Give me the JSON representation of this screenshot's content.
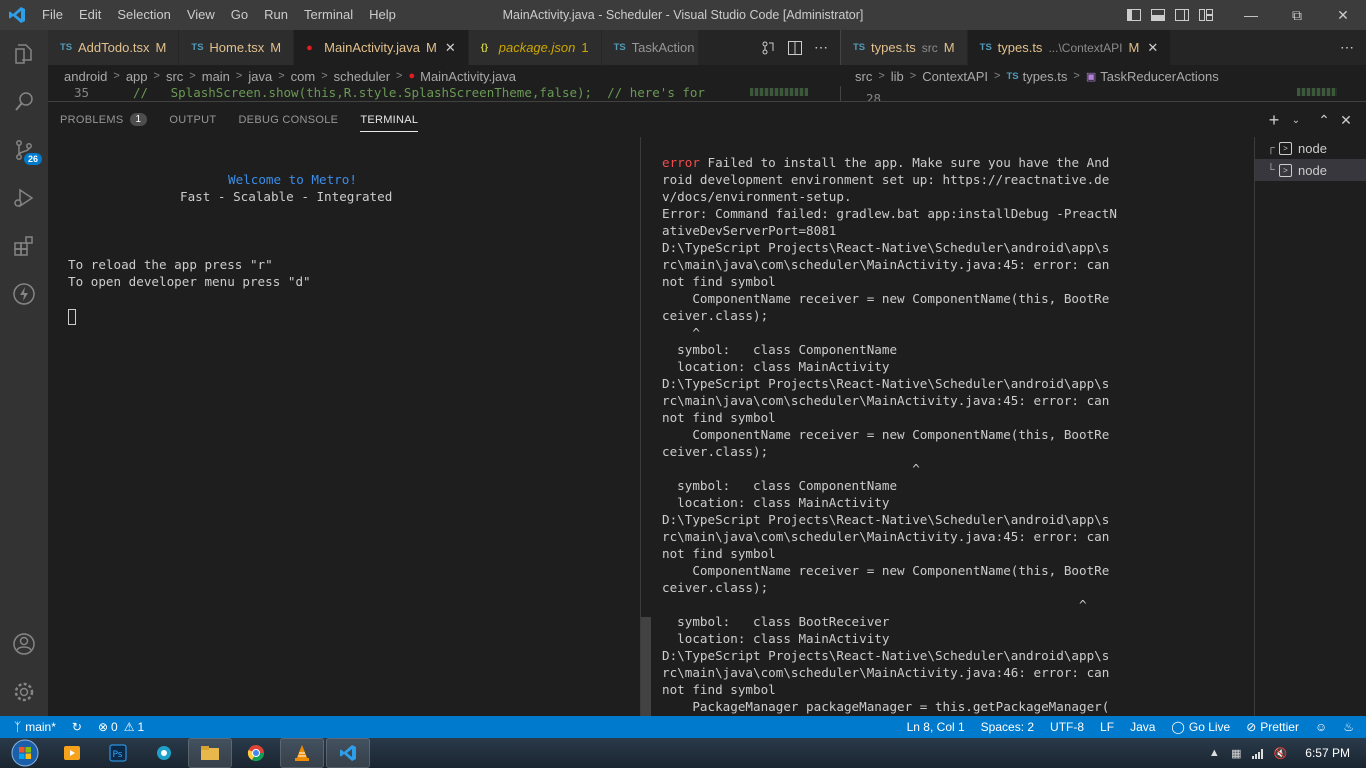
{
  "window": {
    "title": "MainActivity.java - Scheduler - Visual Studio Code [Administrator]",
    "menu": [
      "File",
      "Edit",
      "Selection",
      "View",
      "Go",
      "Run",
      "Terminal",
      "Help"
    ]
  },
  "activity_bar": {
    "scm_badge": "26"
  },
  "tabs_left": [
    {
      "icon": "TS",
      "label": "AddTodo.tsx",
      "status": "M"
    },
    {
      "icon": "TS",
      "label": "Home.tsx",
      "status": "M"
    },
    {
      "icon": "J",
      "label": "MainActivity.java",
      "status": "M"
    },
    {
      "icon": "{}",
      "label": "package.json",
      "status": "1"
    },
    {
      "icon": "TS",
      "label": "TaskAction"
    }
  ],
  "tabs_right": [
    {
      "icon": "TS",
      "label": "types.ts",
      "desc": "src",
      "status": "M"
    },
    {
      "icon": "TS",
      "label": "types.ts",
      "desc": "...\\ContextAPI",
      "status": "M"
    }
  ],
  "breadcrumbs_left": [
    "android",
    "app",
    "src",
    "main",
    "java",
    "com",
    "scheduler",
    "MainActivity.java"
  ],
  "breadcrumbs_right": [
    "src",
    "lib",
    "ContextAPI",
    "types.ts",
    "TaskReducerActions"
  ],
  "editor": {
    "line_number": "35",
    "line_text": "//   SplashScreen.show(this,R.style.SplashScreenTheme,false);  // here's for",
    "right_line_number": "28"
  },
  "panel": {
    "tabs": [
      {
        "label": "PROBLEMS",
        "badge": "1"
      },
      {
        "label": "OUTPUT"
      },
      {
        "label": "DEBUG CONSOLE"
      },
      {
        "label": "TERMINAL"
      }
    ],
    "terminal_left": {
      "welcome": "Welcome to Metro!",
      "tagline": "Fast - Scalable - Integrated",
      "reload_hint": "To reload the app press \"r\"",
      "devmenu_hint": "To open developer menu press \"d\""
    },
    "terminal_right": {
      "error_word": "error",
      "first_line_rest": " Failed to install the app. Make sure you have the And",
      "lines": [
        "roid development environment set up: https://reactnative.de",
        "v/docs/environment-setup.",
        "Error: Command failed: gradlew.bat app:installDebug -PreactN",
        "ativeDevServerPort=8081",
        "D:\\TypeScript Projects\\React-Native\\Scheduler\\android\\app\\s",
        "rc\\main\\java\\com\\scheduler\\MainActivity.java:45: error: can",
        "not find symbol",
        "    ComponentName receiver = new ComponentName(this, BootRe",
        "ceiver.class);",
        "    ^",
        "  symbol:   class ComponentName",
        "  location: class MainActivity",
        "D:\\TypeScript Projects\\React-Native\\Scheduler\\android\\app\\s",
        "rc\\main\\java\\com\\scheduler\\MainActivity.java:45: error: can",
        "not find symbol",
        "    ComponentName receiver = new ComponentName(this, BootRe",
        "ceiver.class);",
        "                                 ^",
        "  symbol:   class ComponentName",
        "  location: class MainActivity",
        "D:\\TypeScript Projects\\React-Native\\Scheduler\\android\\app\\s",
        "rc\\main\\java\\com\\scheduler\\MainActivity.java:45: error: can",
        "not find symbol",
        "    ComponentName receiver = new ComponentName(this, BootRe",
        "ceiver.class);",
        "                                                       ^",
        "  symbol:   class BootReceiver",
        "  location: class MainActivity",
        "D:\\TypeScript Projects\\React-Native\\Scheduler\\android\\app\\s",
        "rc\\main\\java\\com\\scheduler\\MainActivity.java:46: error: can",
        "not find symbol",
        "    PackageManager packageManager = this.getPackageManager("
      ]
    },
    "terminal_list": [
      "node",
      "node"
    ]
  },
  "status_bar": {
    "branch": "main*",
    "errors": "0",
    "warnings": "1",
    "position": "Ln 8, Col 1",
    "spaces": "Spaces: 2",
    "encoding": "UTF-8",
    "eol": "LF",
    "language": "Java",
    "go_live": "Go Live",
    "prettier": "Prettier"
  },
  "taskbar": {
    "clock": "6:57 PM"
  }
}
